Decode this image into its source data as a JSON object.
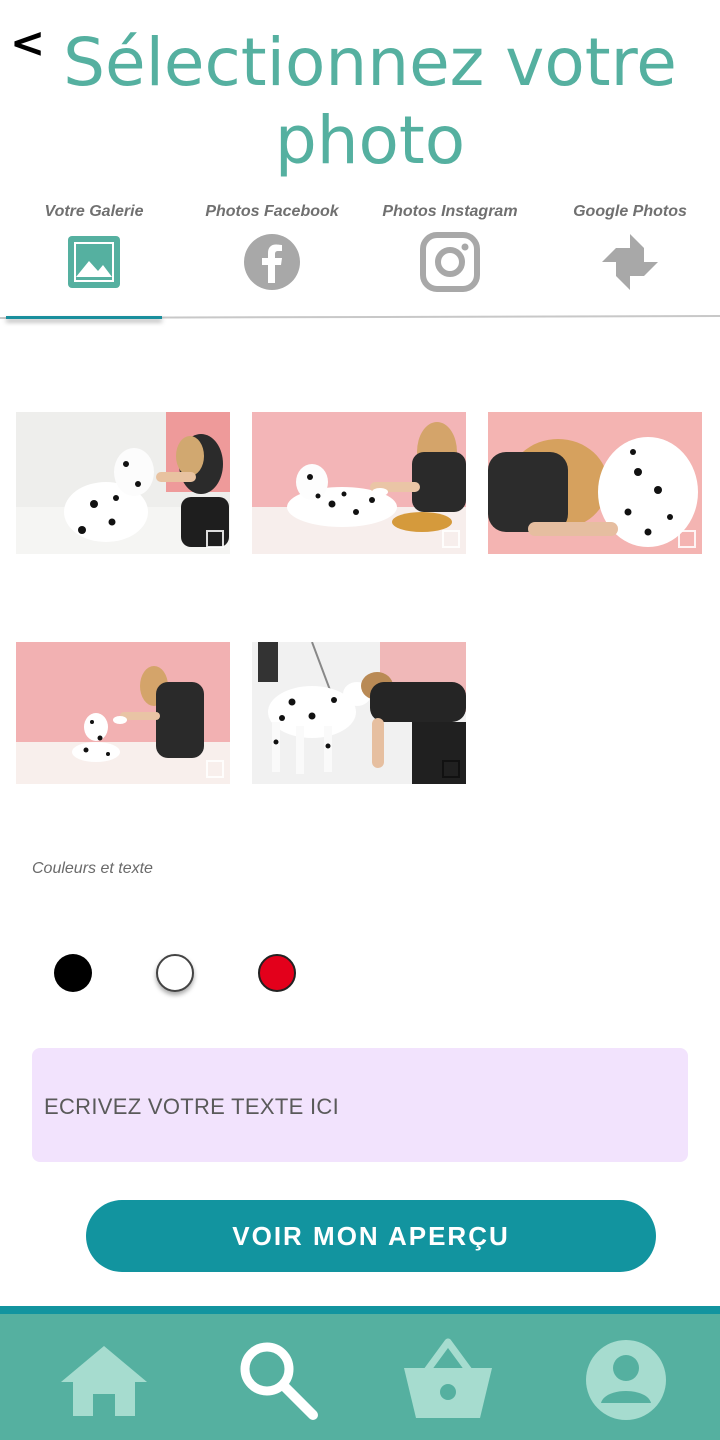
{
  "header": {
    "back_label": "<",
    "title": "Sélectionnez votre photo"
  },
  "tabs": [
    {
      "label": "Votre Galerie",
      "icon": "gallery-icon",
      "active": true
    },
    {
      "label": "Photos Facebook",
      "icon": "facebook-icon",
      "active": false
    },
    {
      "label": "Photos Instagram",
      "icon": "instagram-icon",
      "active": false
    },
    {
      "label": "Google Photos",
      "icon": "google-photos-icon",
      "active": false
    }
  ],
  "photos": [
    {
      "subject": "woman with dalmatian, white room"
    },
    {
      "subject": "woman feeding dalmatian, pink wall"
    },
    {
      "subject": "woman hugging dalmatian, pink wall"
    },
    {
      "subject": "woman kneeling with dalmatian, pink wall"
    },
    {
      "subject": "woman face to face with dalmatian, studio"
    }
  ],
  "colors_section": {
    "label": "Couleurs et texte"
  },
  "swatches": [
    {
      "name": "black",
      "color": "#000000"
    },
    {
      "name": "white",
      "color": "#ffffff"
    },
    {
      "name": "red",
      "color": "#e3001b"
    }
  ],
  "text_field": {
    "placeholder": "ECRIVEZ VOTRE TEXTE ICI"
  },
  "cta": {
    "label": "VOIR MON APERÇU"
  },
  "bottom_nav": [
    {
      "icon": "home-icon"
    },
    {
      "icon": "search-icon"
    },
    {
      "icon": "basket-icon"
    },
    {
      "icon": "profile-icon"
    }
  ],
  "theme": {
    "accent": "#55b0a0",
    "primary": "#12949f",
    "inactive_icon": "#a8a8a8",
    "text_field_bg": "#f2e3fd"
  }
}
